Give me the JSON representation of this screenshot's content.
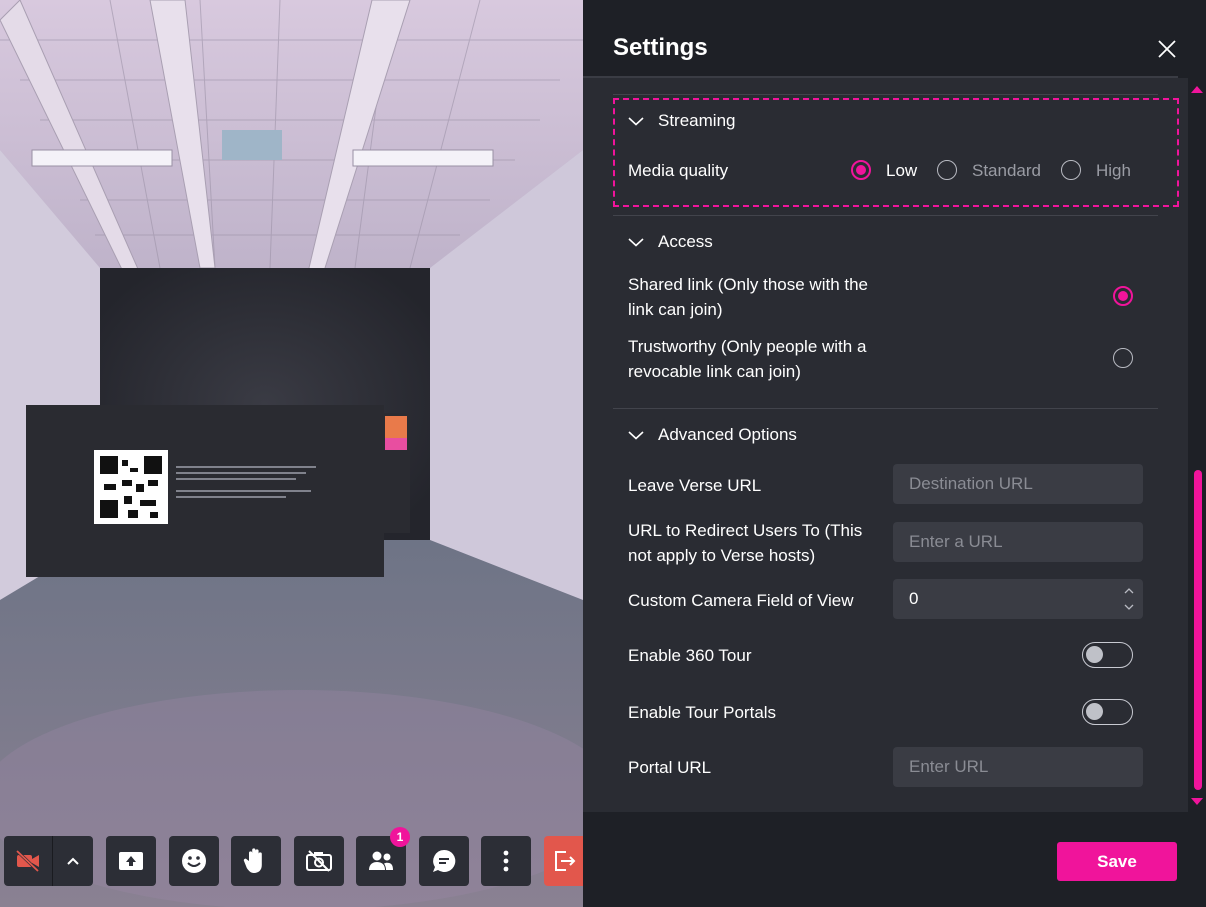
{
  "scene": {
    "toolbar": {
      "badge_count": "1"
    }
  },
  "settings": {
    "title": "Settings",
    "streaming": {
      "heading": "Streaming",
      "media_quality_label": "Media quality",
      "options": [
        "Low",
        "Standard",
        "High"
      ],
      "selected": "Low"
    },
    "access": {
      "heading": "Access",
      "shared_link_line1": "Shared link (Only those with the",
      "shared_link_line2": "link can join)",
      "trustworthy_line1": "Trustworthy (Only people with a",
      "trustworthy_line2": "revocable link can join)",
      "selected": "Shared link"
    },
    "advanced": {
      "heading": "Advanced Options",
      "leave_url_label": "Leave Verse URL",
      "leave_url_placeholder": "Destination URL",
      "redirect_label_line1": "URL to Redirect Users To (This",
      "redirect_label_line2": "not apply to Verse hosts)",
      "redirect_placeholder": "Enter a URL",
      "fov_label": "Custom Camera Field of View",
      "fov_value": "0",
      "tour_label": "Enable 360 Tour",
      "tour_portals_label": "Enable Tour Portals",
      "portal_url_label": "Portal URL",
      "portal_url_placeholder": "Enter URL"
    },
    "save_label": "Save"
  },
  "colors": {
    "accent": "#f0149b",
    "panel_bg": "#2a2c33",
    "header_bg": "#1e2026",
    "input_bg": "#3a3c44",
    "leave_button": "#e2574c"
  }
}
